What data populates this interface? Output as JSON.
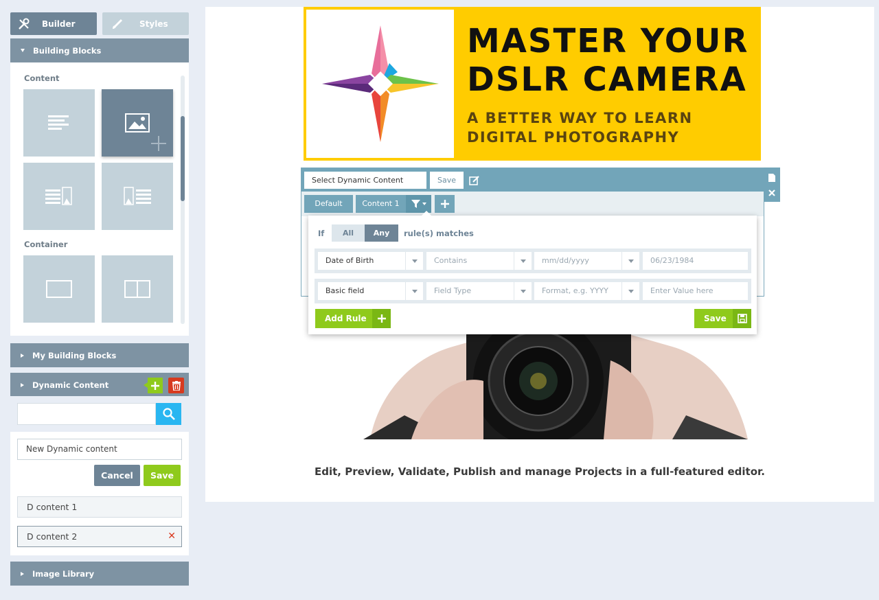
{
  "sidebar": {
    "tabs": {
      "builder": "Builder",
      "styles": "Styles"
    },
    "building_blocks": {
      "title": "Building Blocks",
      "sections": {
        "content": "Content",
        "container": "Container"
      }
    },
    "my_building_blocks": "My Building Blocks",
    "dynamic_content": {
      "title": "Dynamic Content",
      "search_placeholder": "",
      "new_name_value": "New Dynamic content",
      "cancel": "Cancel",
      "save": "Save",
      "items": [
        {
          "label": "D content  1"
        },
        {
          "label": "D content  2"
        }
      ]
    },
    "image_library": "Image Library"
  },
  "canvas": {
    "banner": {
      "title_line1": "MASTER YOUR",
      "title_line2": "DSLR CAMERA",
      "subtitle_line1": "A BETTER WAY TO LEARN",
      "subtitle_line2": "DIGITAL PHOTOGRAPHY"
    },
    "caption": "Edit, Preview, Validate, Publish and manage Projects in a full-featured editor."
  },
  "dynamic_toolbar": {
    "select_label": "Select Dynamic Content",
    "save_label": "Save",
    "tabs": {
      "default": "Default",
      "content1": "Content 1"
    }
  },
  "rules": {
    "if_label": "If",
    "all": "All",
    "any": "Any",
    "match_label": "rule(s) matches",
    "row1": {
      "field": "Date of Birth",
      "operator": "Contains",
      "format": "mm/dd/yyyy",
      "value": "06/23/1984"
    },
    "row2": {
      "field": "Basic field",
      "operator": "Field Type",
      "format": "Format, e.g. YYYY",
      "value": "Enter Value here"
    },
    "add_rule": "Add Rule",
    "save": "Save"
  },
  "colors": {
    "sidebar_header": "#7e93a3",
    "tile": "#c3d2da",
    "tile_active": "#6e8496",
    "green": "#8fca1c",
    "red": "#d73a1f",
    "blue": "#29b6f1",
    "toolbar": "#72a5b9",
    "banner_yellow": "#ffcc00"
  }
}
